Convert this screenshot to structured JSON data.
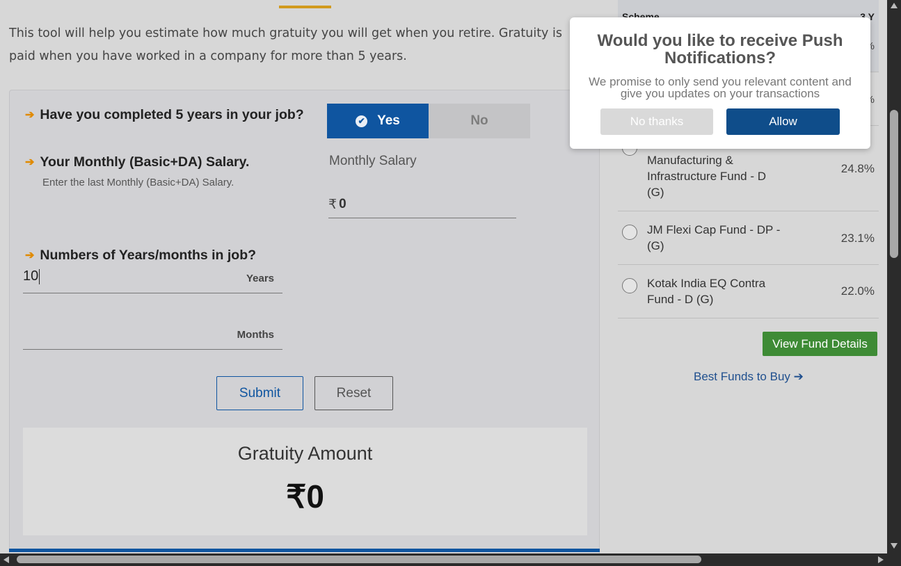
{
  "intro_text": "This tool will help you estimate how much gratuity you will get when you retire. Gratuity is paid when you have worked in a company for more than 5 years.",
  "calculator": {
    "q1": "Have you completed 5 years in your job?",
    "yes_label": "Yes",
    "no_label": "No",
    "q2": "Your Monthly (Basic+DA) Salary.",
    "q2_sub": "Enter the last Monthly (Basic+DA) Salary.",
    "salary_label": "Monthly Salary",
    "currency_symbol": "₹",
    "salary_value": "0",
    "q3": "Numbers of Years/months in job?",
    "years_value": "10",
    "years_unit": "Years",
    "months_value": "",
    "months_unit": "Months",
    "submit_label": "Submit",
    "reset_label": "Reset",
    "result_label": "Gratuity Amount",
    "result_amount": "₹0"
  },
  "sidebar": {
    "header_scheme": "Scheme",
    "header_3y": "3 Y",
    "partial_pct_1": "%",
    "partial_pct_2": "%",
    "funds": [
      {
        "name": "Manufacturing & Infrastructure Fund - D (G)",
        "return": "24.8%"
      },
      {
        "name": "JM Flexi Cap Fund - DP - (G)",
        "return": "23.1%"
      },
      {
        "name": "Kotak India EQ Contra Fund - D (G)",
        "return": "22.0%"
      }
    ],
    "view_button": "View Fund Details",
    "best_link": "Best Funds to Buy"
  },
  "popup": {
    "title": "Would you like to receive Push Notifications?",
    "message": "We promise to only send you relevant content and give you updates on your transactions",
    "no_label": "No thanks",
    "allow_label": "Allow"
  },
  "colors": {
    "primary": "#0f55a0",
    "accent": "#e08a00",
    "green": "#3e8b35"
  }
}
